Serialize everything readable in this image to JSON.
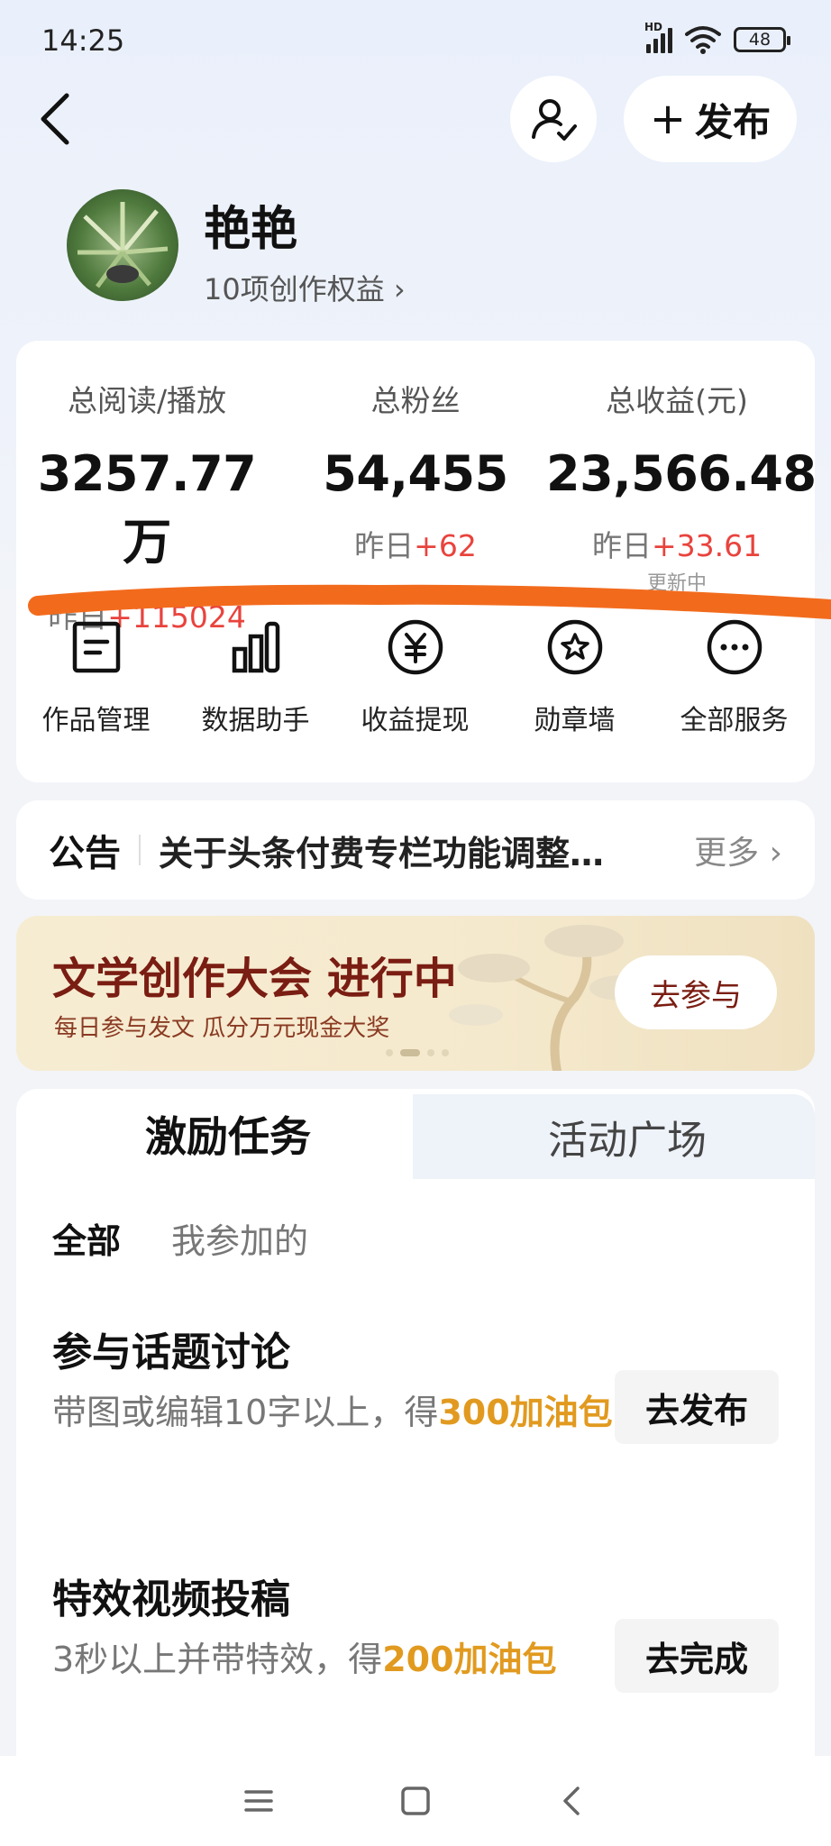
{
  "status_bar": {
    "time": "14:25",
    "network": "HD",
    "battery": "48"
  },
  "header": {
    "publish_label": "发布"
  },
  "profile": {
    "name": "艳艳",
    "rights": "10项创作权益 ›"
  },
  "stats": [
    {
      "label": "总阅读/播放",
      "value": "3257.77万",
      "change_prefix": "昨日",
      "change": "+115024",
      "sub": ""
    },
    {
      "label": "总粉丝",
      "value": "54,455",
      "change_prefix": "昨日",
      "change": "+62",
      "sub": ""
    },
    {
      "label": "总收益(元)",
      "value": "23,566.48",
      "change_prefix": "昨日",
      "change": "+33.61",
      "sub": "更新中"
    }
  ],
  "services": [
    {
      "label": "作品管理",
      "icon": "document-icon"
    },
    {
      "label": "数据助手",
      "icon": "bar-chart-icon"
    },
    {
      "label": "收益提现",
      "icon": "yuan-icon"
    },
    {
      "label": "勋章墙",
      "icon": "medal-icon"
    },
    {
      "label": "全部服务",
      "icon": "more-icon"
    }
  ],
  "notice": {
    "title": "公告",
    "text": "关于头条付费专栏功能调整…",
    "more": "更多 ›"
  },
  "banner": {
    "title": "文学创作大会 进行中",
    "subtitle": "每日参与发文 瓜分万元现金大奖",
    "button": "去参与"
  },
  "tasks": {
    "tabs": [
      "激励任务",
      "活动广场"
    ],
    "filters": [
      "全部",
      "我参加的"
    ],
    "items": [
      {
        "title": "参与话题讨论",
        "desc": "带图或编辑10字以上，得",
        "reward": "300加油包",
        "button": "去发布"
      },
      {
        "title": "特效视频投稿",
        "desc": "3秒以上并带特效，得",
        "reward": "200加油包",
        "button": "去完成"
      }
    ]
  },
  "colors": {
    "accent_red": "#e9433d",
    "reward_orange": "#e19a1f",
    "banner_text": "#7a1d12",
    "highlight_line": "#f26b1d"
  }
}
